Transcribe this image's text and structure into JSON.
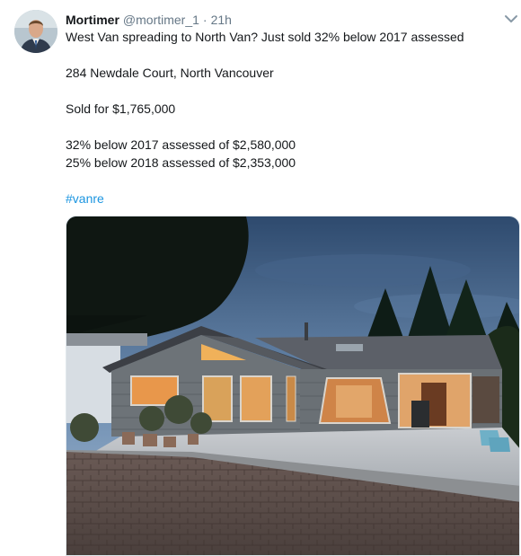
{
  "tweet": {
    "author_name": "Mortimer",
    "handle": "@mortimer_1",
    "separator": "·",
    "time": "21h",
    "lines": [
      "West Van spreading to North Van? Just sold 32% below 2017 assessed",
      "284 Newdale Court, North Vancouver",
      "Sold for $1,765,000",
      "32% below 2017 assessed of $2,580,000",
      "25% below 2018 assessed of $2,353,000"
    ],
    "hashtag": "#vanre"
  },
  "icons": {
    "menu": "chevron-down-icon",
    "avatar": "profile-photo"
  },
  "colors": {
    "link": "#1b95e0",
    "secondary_text": "#657786"
  }
}
